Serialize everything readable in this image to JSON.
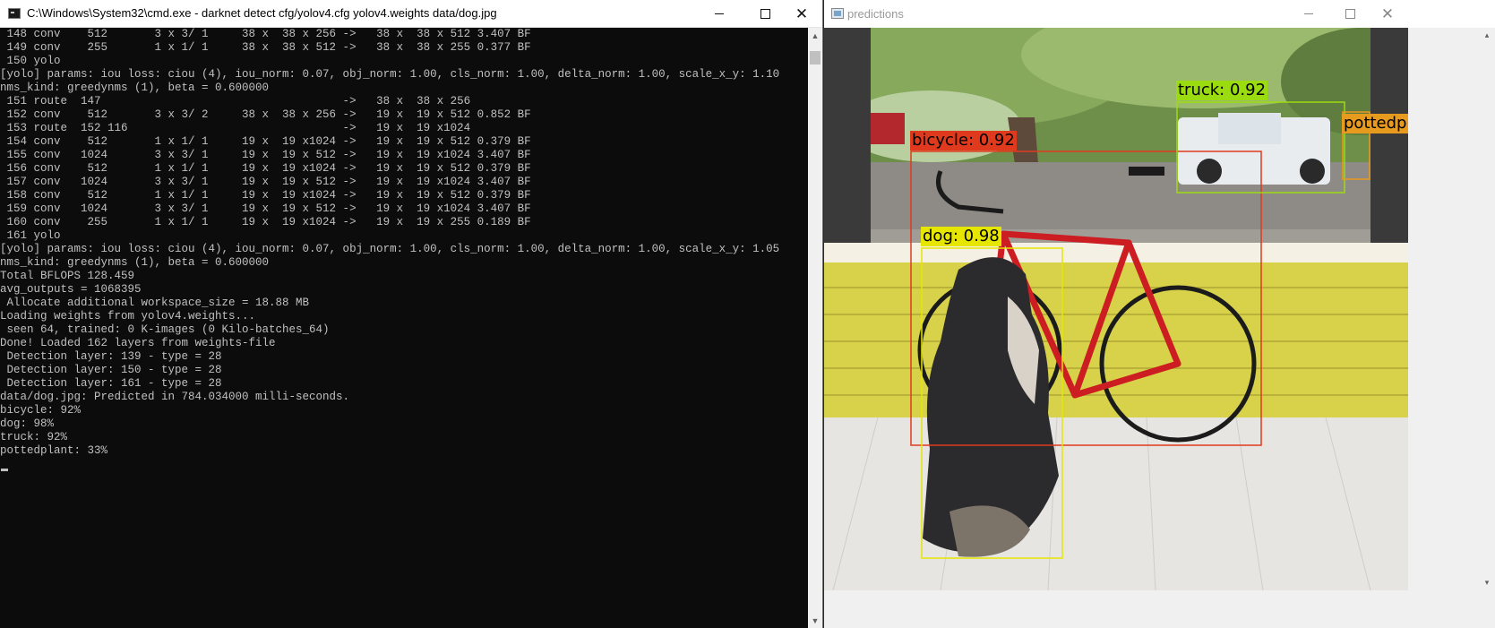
{
  "cmd": {
    "title": "C:\\Windows\\System32\\cmd.exe - darknet  detect cfg/yolov4.cfg yolov4.weights data/dog.jpg",
    "buttons": {
      "minimize": "—",
      "maximize": "☐",
      "close": "✕"
    },
    "lines": [
      " 148 conv    512       3 x 3/ 1     38 x  38 x 256 ->   38 x  38 x 512 3.407 BF",
      " 149 conv    255       1 x 1/ 1     38 x  38 x 512 ->   38 x  38 x 255 0.377 BF",
      " 150 yolo",
      "[yolo] params: iou loss: ciou (4), iou_norm: 0.07, obj_norm: 1.00, cls_norm: 1.00, delta_norm: 1.00, scale_x_y: 1.10",
      "nms_kind: greedynms (1), beta = 0.600000",
      " 151 route  147                                    ->   38 x  38 x 256",
      " 152 conv    512       3 x 3/ 2     38 x  38 x 256 ->   19 x  19 x 512 0.852 BF",
      " 153 route  152 116                                ->   19 x  19 x1024",
      " 154 conv    512       1 x 1/ 1     19 x  19 x1024 ->   19 x  19 x 512 0.379 BF",
      " 155 conv   1024       3 x 3/ 1     19 x  19 x 512 ->   19 x  19 x1024 3.407 BF",
      " 156 conv    512       1 x 1/ 1     19 x  19 x1024 ->   19 x  19 x 512 0.379 BF",
      " 157 conv   1024       3 x 3/ 1     19 x  19 x 512 ->   19 x  19 x1024 3.407 BF",
      " 158 conv    512       1 x 1/ 1     19 x  19 x1024 ->   19 x  19 x 512 0.379 BF",
      " 159 conv   1024       3 x 3/ 1     19 x  19 x 512 ->   19 x  19 x1024 3.407 BF",
      " 160 conv    255       1 x 1/ 1     19 x  19 x1024 ->   19 x  19 x 255 0.189 BF",
      " 161 yolo",
      "[yolo] params: iou loss: ciou (4), iou_norm: 0.07, obj_norm: 1.00, cls_norm: 1.00, delta_norm: 1.00, scale_x_y: 1.05",
      "nms_kind: greedynms (1), beta = 0.600000",
      "Total BFLOPS 128.459",
      "avg_outputs = 1068395",
      " Allocate additional workspace_size = 18.88 MB",
      "Loading weights from yolov4.weights...",
      " seen 64, trained: 0 K-images (0 Kilo-batches_64)",
      "Done! Loaded 162 layers from weights-file",
      " Detection layer: 139 - type = 28",
      " Detection layer: 150 - type = 28",
      " Detection layer: 161 - type = 28",
      "data/dog.jpg: Predicted in 784.034000 milli-seconds.",
      "bicycle: 92%",
      "dog: 98%",
      "truck: 92%",
      "pottedplant: 33%"
    ],
    "scroll": {
      "up": "▲",
      "down": "▼"
    }
  },
  "predictions": {
    "title": "predictions",
    "buttons": {
      "minimize": "—",
      "maximize": "☐",
      "close": "✕"
    },
    "detections": [
      {
        "label": "bicycle: 0.92",
        "color": "#e03a1e"
      },
      {
        "label": "truck: 0.92",
        "color": "#9bdc10"
      },
      {
        "label": "dog: 0.98",
        "color": "#e6e600"
      },
      {
        "label": "pottedpl",
        "color": "#e69a1e"
      }
    ]
  }
}
